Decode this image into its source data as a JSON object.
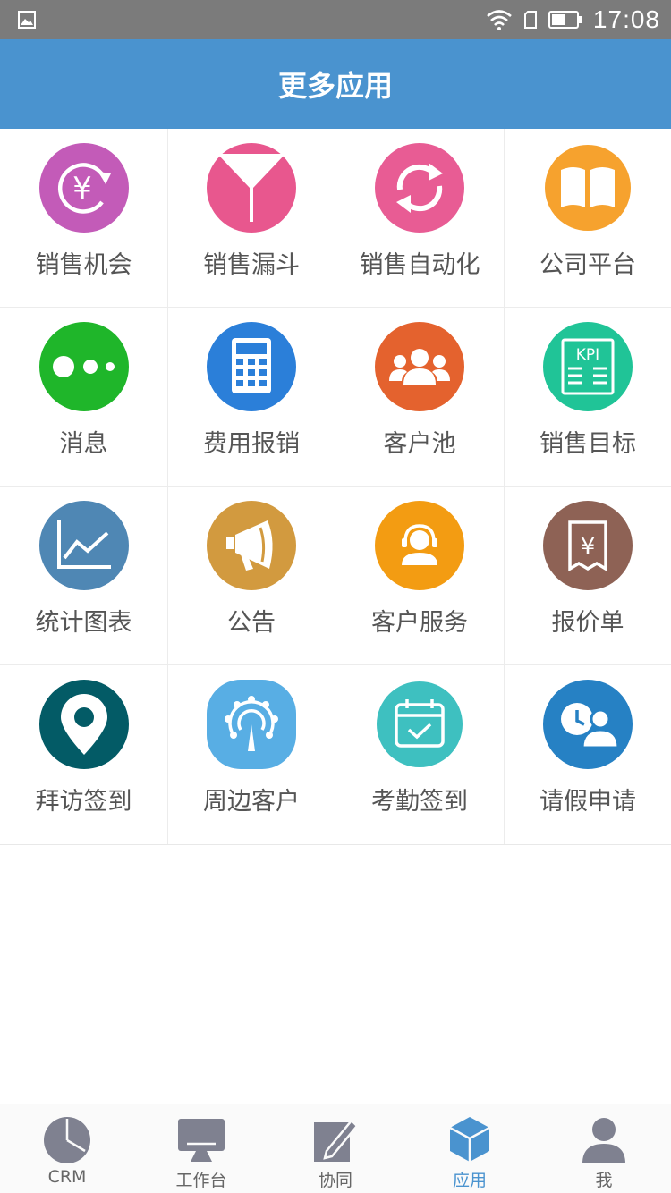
{
  "status_bar": {
    "time": "17:08"
  },
  "header": {
    "title": "更多应用"
  },
  "apps": [
    {
      "label": "销售机会"
    },
    {
      "label": "销售漏斗"
    },
    {
      "label": "销售自动化"
    },
    {
      "label": "公司平台"
    },
    {
      "label": "消息"
    },
    {
      "label": "费用报销"
    },
    {
      "label": "客户池"
    },
    {
      "label": "销售目标"
    },
    {
      "label": "统计图表"
    },
    {
      "label": "公告"
    },
    {
      "label": "客户服务"
    },
    {
      "label": "报价单"
    },
    {
      "label": "拜访签到"
    },
    {
      "label": "周边客户"
    },
    {
      "label": "考勤签到"
    },
    {
      "label": "请假申请"
    }
  ],
  "icons": {
    "opportunity": {
      "glyph": "¥",
      "color": "#c35bb8"
    },
    "kpi": {
      "glyph": "KPI",
      "color": "#20c497"
    },
    "quote": {
      "glyph": "¥",
      "color": "#8e6255"
    }
  },
  "tabbar": [
    {
      "label": "CRM"
    },
    {
      "label": "工作台"
    },
    {
      "label": "协同"
    },
    {
      "label": "应用",
      "active": true
    },
    {
      "label": "我"
    }
  ],
  "colors": {
    "status_bar": "#7b7b7b",
    "title_bar": "#4a93cf",
    "tab_active": "#4a93cf",
    "tab_inactive": "#7f8190"
  }
}
